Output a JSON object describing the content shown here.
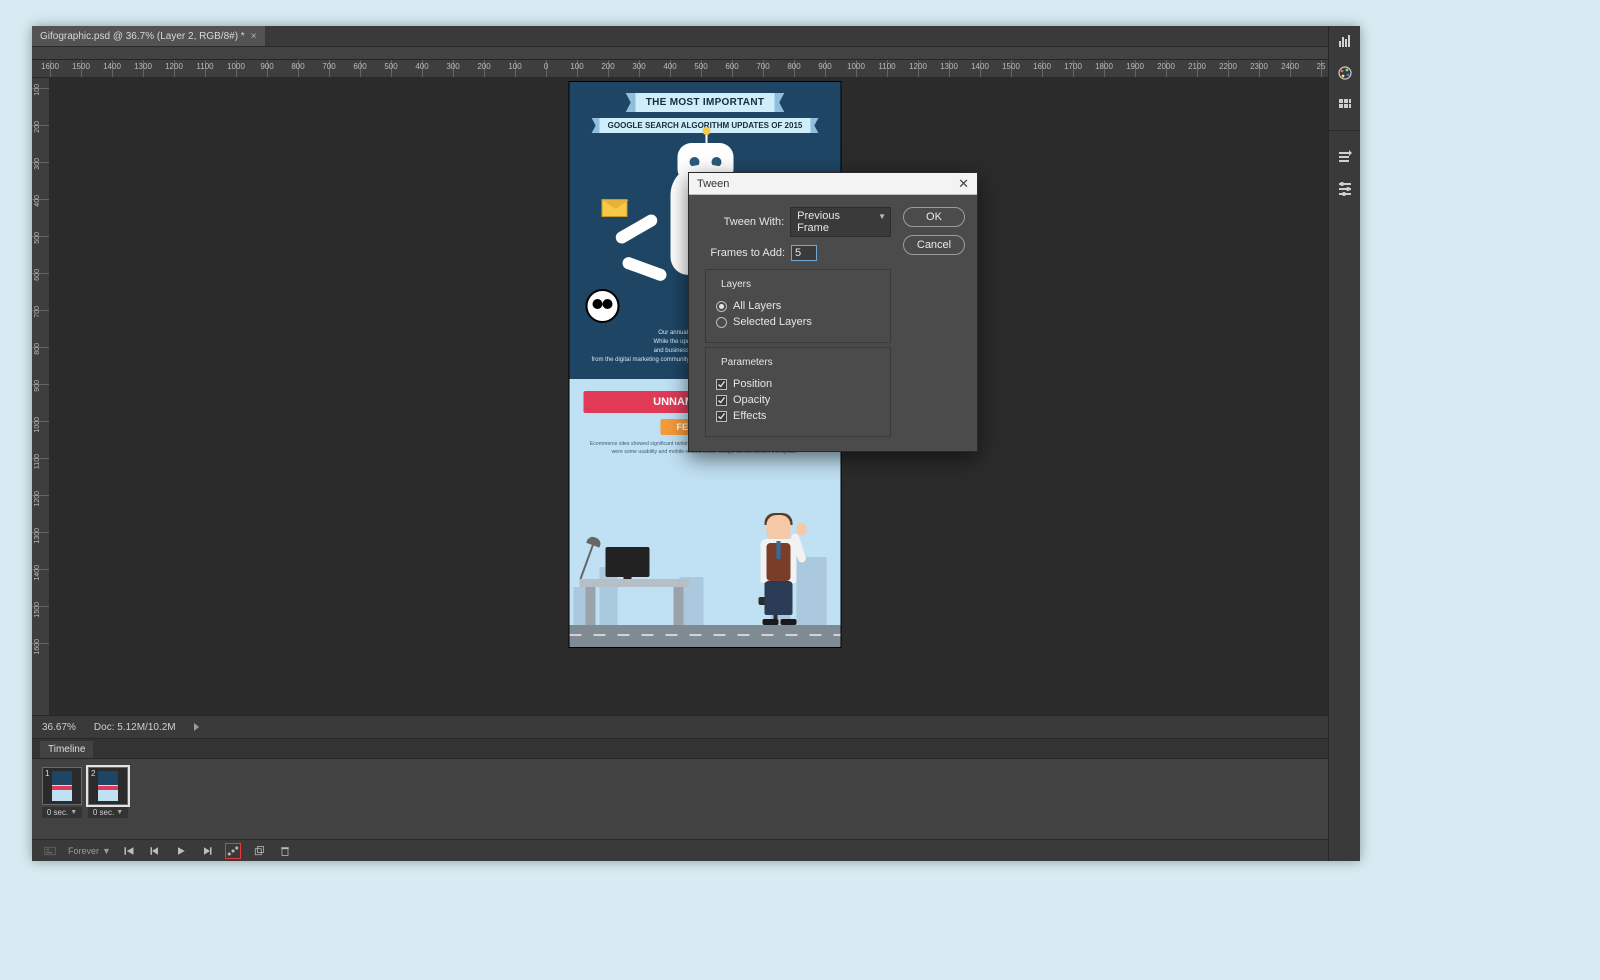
{
  "tab": {
    "title": "Gifographic.psd @ 36.7% (Layer 2, RGB/8#) *",
    "close": "×"
  },
  "ruler": {
    "h": [
      "1600",
      "1500",
      "1400",
      "1300",
      "1200",
      "1100",
      "1000",
      "900",
      "800",
      "700",
      "600",
      "500",
      "400",
      "300",
      "200",
      "100",
      "0",
      "100",
      "200",
      "300",
      "400",
      "500",
      "600",
      "700",
      "800",
      "900",
      "1000",
      "1100",
      "1200",
      "1300",
      "1400",
      "1500",
      "1600",
      "1700",
      "1800",
      "1900",
      "2000",
      "2100",
      "2200",
      "2300",
      "2400",
      "25"
    ],
    "v": [
      "100",
      "200",
      "300",
      "400",
      "500",
      "600",
      "700",
      "800",
      "900",
      "1000",
      "1100",
      "1200",
      "1300",
      "1400",
      "1500",
      "1600"
    ]
  },
  "infographic": {
    "title1": "THE MOST IMPORTANT",
    "title2": "GOOGLE SEARCH ALGORITHM UPDATES OF 2015",
    "copy1": "Our annual visual analysis of the m",
    "copy2": "While the updates are getting progress",
    "copy3": "and business impact, their significance",
    "copy4": "from the digital marketing community continue to be just as animated as our graphics!",
    "update_name": "UNNAMED UPDATE",
    "update_date": "FEBRUARY 4",
    "update_copy": "Ecommerce sites showed significant ranking changes for traffic-heavy and branded keywords. There were some usability and mobile-related shifts. Google did not confirm this update."
  },
  "status": {
    "zoom": "36.67%",
    "doc": "Doc: 5.12M/10.2M"
  },
  "timeline": {
    "tab": "Timeline",
    "frames": [
      {
        "num": "1",
        "delay": "0 sec."
      },
      {
        "num": "2",
        "delay": "0 sec."
      }
    ],
    "loop": "Forever"
  },
  "dialog": {
    "title": "Tween",
    "tween_with_label": "Tween With:",
    "tween_with_value": "Previous Frame",
    "frames_to_add_label": "Frames to Add:",
    "frames_to_add_value": "5",
    "layers_legend": "Layers",
    "layers_all": "All Layers",
    "layers_selected": "Selected Layers",
    "params_legend": "Parameters",
    "param_position": "Position",
    "param_opacity": "Opacity",
    "param_effects": "Effects",
    "ok": "OK",
    "cancel": "Cancel"
  },
  "collapse": "◀◀"
}
